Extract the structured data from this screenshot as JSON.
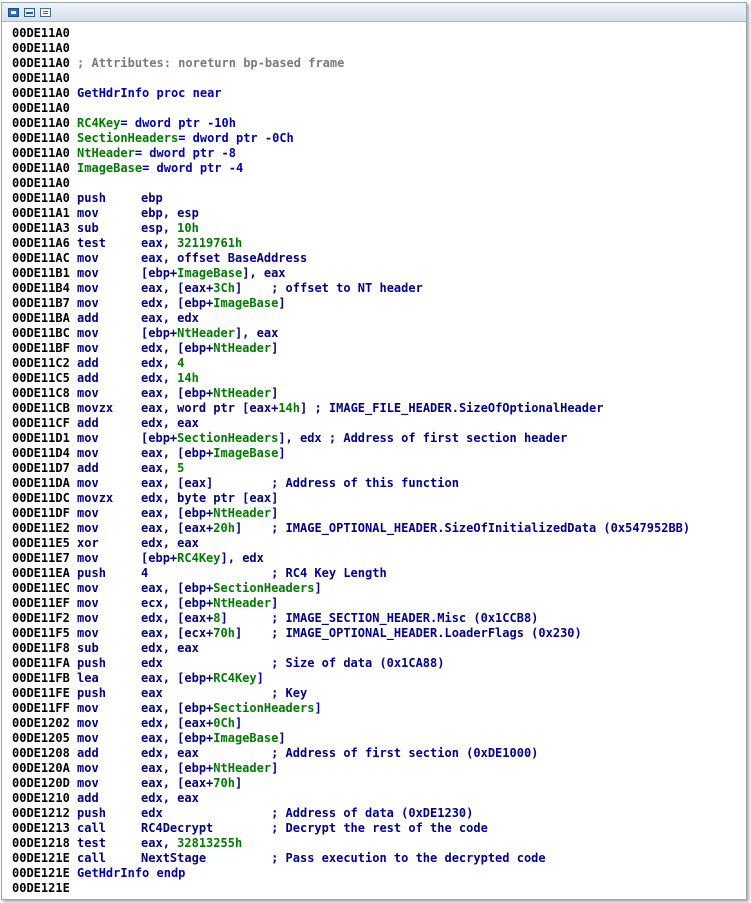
{
  "toolbar": {
    "icons": [
      "graph-view-icon",
      "text-view-icon",
      "hex-view-icon"
    ]
  },
  "lines": [
    {
      "addr": "00DE11A0"
    },
    {
      "addr": "00DE11A0"
    },
    {
      "addr": "00DE11A0",
      "text": "; Attributes: noreturn bp-based frame",
      "kind": "comment"
    },
    {
      "addr": "00DE11A0"
    },
    {
      "addr": "00DE11A0",
      "text": "GetHdrInfo proc near",
      "kind": "func"
    },
    {
      "addr": "00DE11A0"
    },
    {
      "addr": "00DE11A0",
      "var": "RC4Key",
      "text": "= dword ptr -10h",
      "kind": "vardef"
    },
    {
      "addr": "00DE11A0",
      "var": "SectionHeaders",
      "text": "= dword ptr -0Ch",
      "kind": "vardef"
    },
    {
      "addr": "00DE11A0",
      "var": "NtHeader",
      "text": "= dword ptr -8",
      "kind": "vardef"
    },
    {
      "addr": "00DE11A0",
      "var": "ImageBase",
      "text": "= dword ptr -4",
      "kind": "vardef"
    },
    {
      "addr": "00DE11A0"
    },
    {
      "addr": "00DE11A0",
      "mn": "push",
      "op": "ebp"
    },
    {
      "addr": "00DE11A1",
      "mn": "mov",
      "op": "ebp, esp"
    },
    {
      "addr": "00DE11A3",
      "mn": "sub",
      "op": "esp, 10h"
    },
    {
      "addr": "00DE11A6",
      "mn": "test",
      "op": "eax, 32119761h"
    },
    {
      "addr": "00DE11AC",
      "mn": "mov",
      "op": "eax, offset BaseAddress"
    },
    {
      "addr": "00DE11B1",
      "mn": "mov",
      "op": "[ebp+ImageBase], eax"
    },
    {
      "addr": "00DE11B4",
      "mn": "mov",
      "op": "eax, [eax+3Ch]",
      "cmt": "; offset to NT header"
    },
    {
      "addr": "00DE11B7",
      "mn": "mov",
      "op": "edx, [ebp+ImageBase]"
    },
    {
      "addr": "00DE11BA",
      "mn": "add",
      "op": "eax, edx"
    },
    {
      "addr": "00DE11BC",
      "mn": "mov",
      "op": "[ebp+NtHeader], eax"
    },
    {
      "addr": "00DE11BF",
      "mn": "mov",
      "op": "edx, [ebp+NtHeader]"
    },
    {
      "addr": "00DE11C2",
      "mn": "add",
      "op": "edx, 4"
    },
    {
      "addr": "00DE11C5",
      "mn": "add",
      "op": "edx, 14h"
    },
    {
      "addr": "00DE11C8",
      "mn": "mov",
      "op": "eax, [ebp+NtHeader]"
    },
    {
      "addr": "00DE11CB",
      "mn": "movzx",
      "op": "eax, word ptr [eax+14h]",
      "cmt": "; IMAGE_FILE_HEADER.SizeOfOptionalHeader"
    },
    {
      "addr": "00DE11CF",
      "mn": "add",
      "op": "edx, eax"
    },
    {
      "addr": "00DE11D1",
      "mn": "mov",
      "op": "[ebp+SectionHeaders], edx",
      "cmt": "; Address of first section header"
    },
    {
      "addr": "00DE11D4",
      "mn": "mov",
      "op": "eax, [ebp+ImageBase]"
    },
    {
      "addr": "00DE11D7",
      "mn": "add",
      "op": "eax, 5"
    },
    {
      "addr": "00DE11DA",
      "mn": "mov",
      "op": "eax, [eax]",
      "cmt": "; Address of this function"
    },
    {
      "addr": "00DE11DC",
      "mn": "movzx",
      "op": "edx, byte ptr [eax]"
    },
    {
      "addr": "00DE11DF",
      "mn": "mov",
      "op": "eax, [ebp+NtHeader]"
    },
    {
      "addr": "00DE11E2",
      "mn": "mov",
      "op": "eax, [eax+20h]",
      "cmt": "; IMAGE_OPTIONAL_HEADER.SizeOfInitializedData (0x547952BB)"
    },
    {
      "addr": "00DE11E5",
      "mn": "xor",
      "op": "edx, eax"
    },
    {
      "addr": "00DE11E7",
      "mn": "mov",
      "op": "[ebp+RC4Key], edx"
    },
    {
      "addr": "00DE11EA",
      "mn": "push",
      "op": "4",
      "cmt": "; RC4 Key Length"
    },
    {
      "addr": "00DE11EC",
      "mn": "mov",
      "op": "eax, [ebp+SectionHeaders]"
    },
    {
      "addr": "00DE11EF",
      "mn": "mov",
      "op": "ecx, [ebp+NtHeader]"
    },
    {
      "addr": "00DE11F2",
      "mn": "mov",
      "op": "edx, [eax+8]",
      "cmt": "; IMAGE_SECTION_HEADER.Misc (0x1CCB8)"
    },
    {
      "addr": "00DE11F5",
      "mn": "mov",
      "op": "eax, [ecx+70h]",
      "cmt": "; IMAGE_OPTIONAL_HEADER.LoaderFlags (0x230)"
    },
    {
      "addr": "00DE11F8",
      "mn": "sub",
      "op": "edx, eax"
    },
    {
      "addr": "00DE11FA",
      "mn": "push",
      "op": "edx",
      "cmt": "; Size of data (0x1CA88)"
    },
    {
      "addr": "00DE11FB",
      "mn": "lea",
      "op": "eax, [ebp+RC4Key]"
    },
    {
      "addr": "00DE11FE",
      "mn": "push",
      "op": "eax",
      "cmt": "; Key"
    },
    {
      "addr": "00DE11FF",
      "mn": "mov",
      "op": "eax, [ebp+SectionHeaders]"
    },
    {
      "addr": "00DE1202",
      "mn": "mov",
      "op": "edx, [eax+0Ch]"
    },
    {
      "addr": "00DE1205",
      "mn": "mov",
      "op": "eax, [ebp+ImageBase]"
    },
    {
      "addr": "00DE1208",
      "mn": "add",
      "op": "edx, eax",
      "cmt": "; Address of first section (0xDE1000)"
    },
    {
      "addr": "00DE120A",
      "mn": "mov",
      "op": "eax, [ebp+NtHeader]"
    },
    {
      "addr": "00DE120D",
      "mn": "mov",
      "op": "eax, [eax+70h]"
    },
    {
      "addr": "00DE1210",
      "mn": "add",
      "op": "edx, eax"
    },
    {
      "addr": "00DE1212",
      "mn": "push",
      "op": "edx",
      "cmt": "; Address of data (0xDE1230)"
    },
    {
      "addr": "00DE1213",
      "mn": "call",
      "op": "RC4Decrypt",
      "cmt": "; Decrypt the rest of the code"
    },
    {
      "addr": "00DE1218",
      "mn": "test",
      "op": "eax, 32813255h"
    },
    {
      "addr": "00DE121E",
      "mn": "call",
      "op": "NextStage",
      "cmt": "; Pass execution to the decrypted code"
    },
    {
      "addr": "00DE121E",
      "text": "GetHdrInfo endp",
      "kind": "func"
    },
    {
      "addr": "00DE121E"
    }
  ]
}
